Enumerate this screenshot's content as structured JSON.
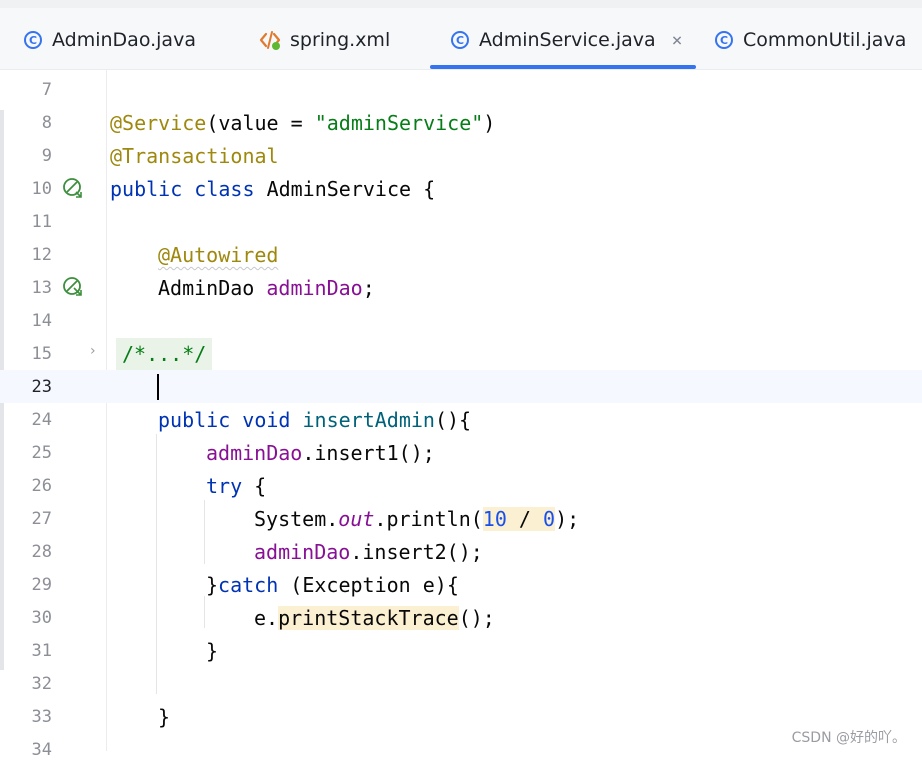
{
  "tabs": [
    {
      "label": "AdminDao.java",
      "icon": "java-class-icon"
    },
    {
      "label": "spring.xml",
      "icon": "xml-file-icon"
    },
    {
      "label": "AdminService.java",
      "icon": "java-class-icon",
      "active": true
    },
    {
      "label": "CommonUtil.java",
      "icon": "java-class-icon"
    }
  ],
  "close_glyph": "×",
  "class_icon_letter": "C",
  "lines": {
    "l7": {
      "num": "7"
    },
    "l8": {
      "num": "8",
      "ann": "@Service",
      "open": "(value = ",
      "str": "\"adminService\"",
      "close": ")"
    },
    "l9": {
      "num": "9",
      "ann": "@Transactional"
    },
    "l10": {
      "num": "10",
      "kw1": "public",
      "kw2": "class",
      "name": "AdminService {"
    },
    "l11": {
      "num": "11"
    },
    "l12": {
      "num": "12",
      "ann": "@Autowired"
    },
    "l13": {
      "num": "13",
      "type": "AdminDao ",
      "field": "adminDao",
      "semi": ";"
    },
    "l14": {
      "num": "14"
    },
    "l15": {
      "num": "15",
      "fold": "/*...*/"
    },
    "l23": {
      "num": "23"
    },
    "l24": {
      "num": "24",
      "kw1": "public",
      "kw2": "void",
      "method": "insertAdmin",
      "rest": "(){"
    },
    "l25": {
      "num": "25",
      "field": "adminDao",
      "rest": ".insert1();"
    },
    "l26": {
      "num": "26",
      "kw": "try",
      "rest": " {"
    },
    "l27": {
      "num": "27",
      "pre": "System.",
      "out": "out",
      "mid": ".println(",
      "n1": "10",
      "op": " / ",
      "n2": "0",
      "end": ");"
    },
    "l28": {
      "num": "28",
      "field": "adminDao",
      "rest": ".insert2();"
    },
    "l29": {
      "num": "29",
      "brace": "}",
      "kw": "catch",
      "rest": " (Exception e){"
    },
    "l30": {
      "num": "30",
      "pre": "e.",
      "method": "printStackTrace",
      "rest": "();"
    },
    "l31": {
      "num": "31",
      "brace": "}"
    },
    "l32": {
      "num": "32"
    },
    "l33": {
      "num": "33",
      "brace": "}"
    },
    "l34": {
      "num": "34"
    }
  },
  "watermark": "CSDN @好的吖。",
  "colors": {
    "annotation": "#9e880d",
    "keyword": "#0033b3",
    "string": "#067d17",
    "field": "#871094",
    "method": "#00627a",
    "number": "#1750eb",
    "accent": "#3574f0"
  }
}
